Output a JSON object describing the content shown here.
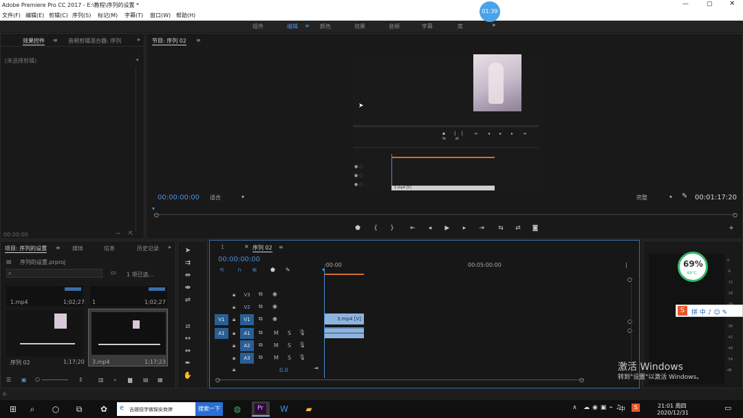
{
  "app": {
    "title": "Adobe Premiere Pro CC 2017 - E:\\教程\\序列的设置 *",
    "timer": "01:39"
  },
  "menu": [
    "文件(F)",
    "编辑(E)",
    "剪辑(C)",
    "序列(S)",
    "标记(M)",
    "字幕(T)",
    "窗口(W)",
    "帮助(H)"
  ],
  "workspaces": [
    "组件",
    "编辑",
    "颜色",
    "效果",
    "音频",
    "字幕",
    "库"
  ],
  "source_panel": {
    "tabs": [
      "效果控件",
      "音频剪辑混合器: 序列"
    ],
    "hint": "(未选择剪辑)",
    "timecode": "00:00:00"
  },
  "program": {
    "title": "节目: 序列 02",
    "timecode_left": "00:00:00:00",
    "fit": "适合",
    "quality": "完整",
    "timecode_right": "00:01:17:20",
    "inner_clip": "1.mp4 [V]"
  },
  "project": {
    "tabs": [
      "项目: 序列的设置",
      "媒体",
      "信息",
      "历史记录"
    ],
    "file": "序列的设置.prproj",
    "selected": "1 项已选...",
    "items": [
      {
        "name": "1.mp4",
        "dur": "1;02;27"
      },
      {
        "name": "1",
        "dur": "1;02;27"
      },
      {
        "name": "序列 02",
        "dur": "1;17;20"
      },
      {
        "name": "3.mp4",
        "dur": "1;17;23"
      }
    ]
  },
  "timeline": {
    "tabs": [
      "1",
      "序列 02"
    ],
    "timecode": "00:00:00:00",
    "ruler": [
      ":00:00",
      "00:05:00:00"
    ],
    "tracks": [
      "V3",
      "V2",
      "V1",
      "A1",
      "A2",
      "A3"
    ],
    "src_v": "V1",
    "src_a": "A1",
    "clip_v": "3.mp4 [V]",
    "master_val": "0.0",
    "m": "M",
    "s": "S"
  },
  "overlay": {
    "percent": "69%",
    "temp": "49°C",
    "ime": "拼 中 ♪ ☺ ✎",
    "activate_title": "激活 Windows",
    "activate_sub": "转到\"设置\"以激活 Windows。"
  },
  "meter_labels": [
    "0",
    "-6",
    "-12",
    "-18",
    "-24",
    "-30",
    "-36",
    "-42",
    "-48",
    "-54",
    "dB"
  ],
  "taskbar": {
    "search": "吉娜娅学做锦安商婷",
    "search_btn": "搜索一下",
    "time": "21:01 周四",
    "date": "2020/12/31",
    "ime": "中"
  }
}
